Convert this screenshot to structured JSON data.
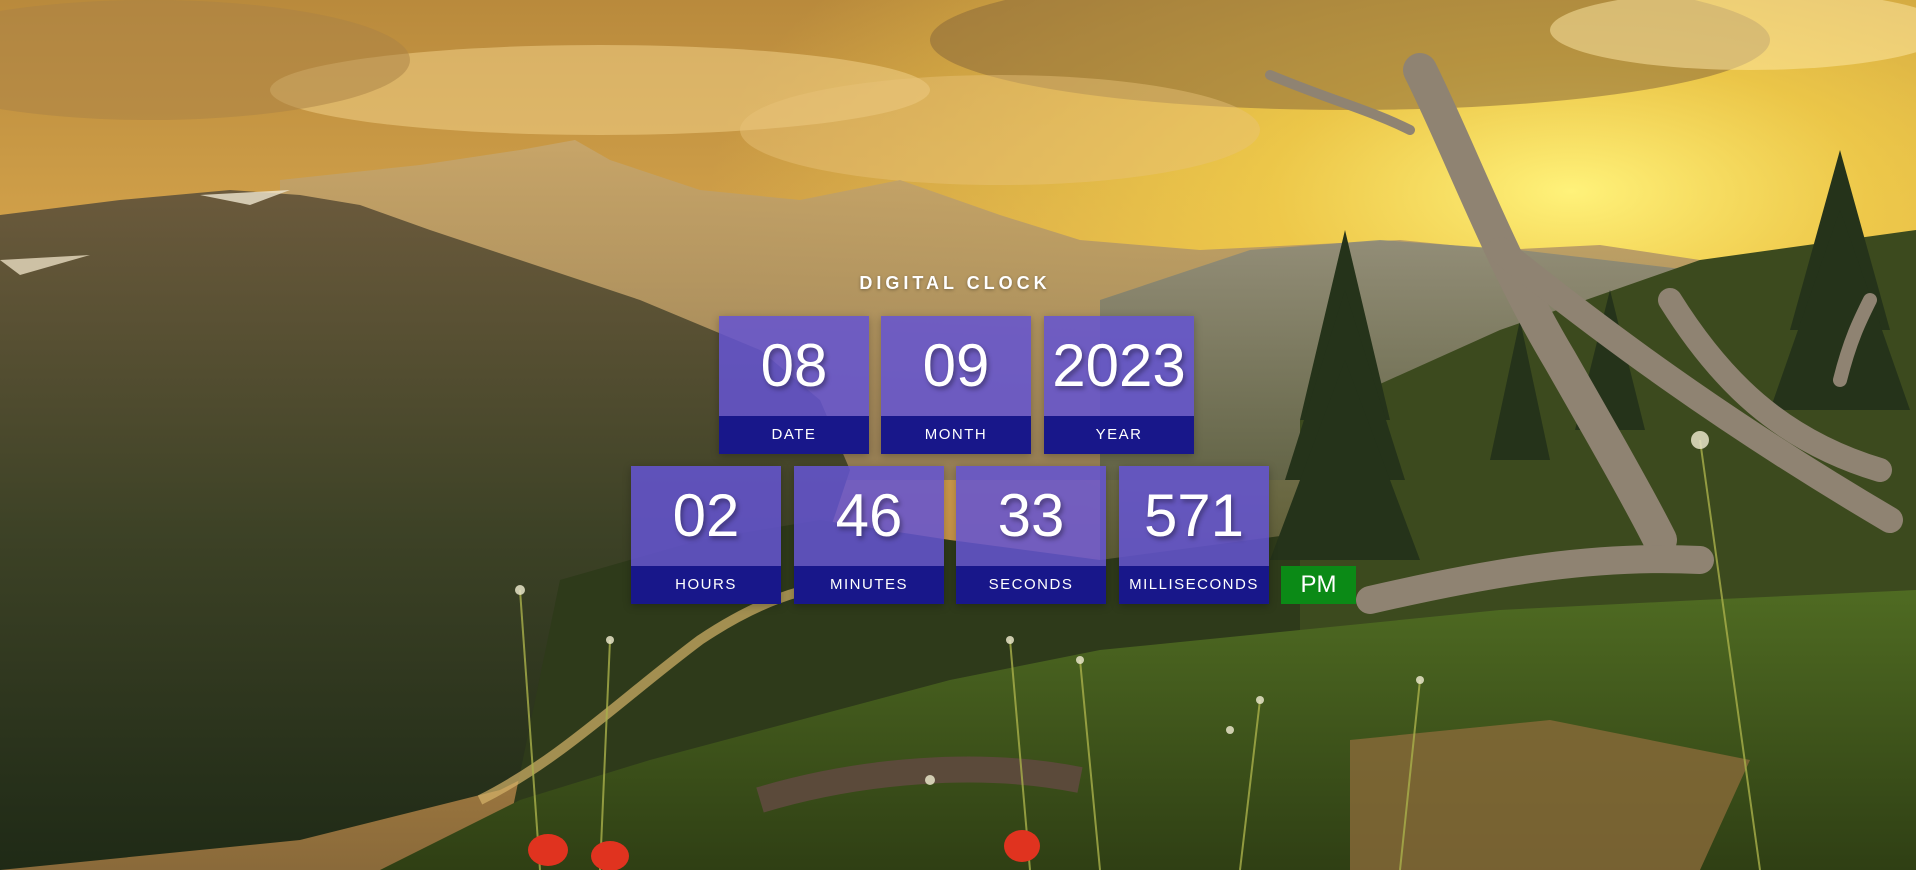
{
  "clock": {
    "title": "DIGITAL CLOCK",
    "date": {
      "value": "08",
      "label": "DATE"
    },
    "month": {
      "value": "09",
      "label": "MONTH"
    },
    "year": {
      "value": "2023",
      "label": "YEAR"
    },
    "hours": {
      "value": "02",
      "label": "HOURS"
    },
    "minutes": {
      "value": "46",
      "label": "MINUTES"
    },
    "seconds": {
      "value": "33",
      "label": "SECONDS"
    },
    "milliseconds": {
      "value": "571",
      "label": "MILLISECONDS"
    },
    "meridiem": "PM"
  },
  "colors": {
    "tile_value_bg": "#6454d2",
    "tile_label_bg": "#18178a",
    "meridiem_bg": "#0b8a16",
    "text": "#ffffff"
  },
  "background": {
    "scene": "mountain-sunset-landscape"
  }
}
